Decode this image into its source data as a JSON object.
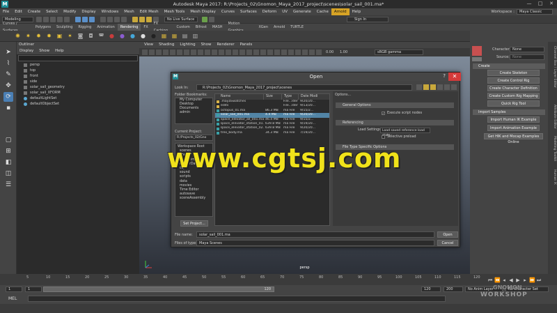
{
  "window": {
    "title": "Autodesk Maya 2017: R:\\Projects_02\\Gnomon_Maya_2017_project\\scenes\\solar_sail_001.ma*",
    "app_icon": "M",
    "minimize": "—",
    "maximize": "□",
    "close": "✕"
  },
  "menubar": {
    "items": [
      "File",
      "Edit",
      "Create",
      "Select",
      "Modify",
      "Display",
      "Windows",
      "Mesh",
      "Edit Mesh",
      "Mesh Tools",
      "Mesh Display",
      "Curves",
      "Surfaces",
      "Deform",
      "UV",
      "Generate",
      "Cache",
      "Arnold",
      "Help"
    ],
    "highlighted_index": 17,
    "workspace_label": "Workspace :",
    "workspace_value": "Maya Classic"
  },
  "statusline": {
    "mode": "Modeling",
    "live_surface": "No Live Surface",
    "sign_in": "Sign In"
  },
  "shelf_tabs": {
    "items": [
      "Curves / Surfaces",
      "Polygons",
      "Sculpting",
      "Rigging",
      "Animation",
      "Rendering",
      "FX",
      "FX Caching",
      "Custom",
      "Bifrost",
      "MASH",
      "Motion Graphics",
      "XGen",
      "Arnold",
      "TURTLE"
    ],
    "active_index": 5
  },
  "outliner": {
    "title": "Outliner",
    "menu": [
      "Display",
      "Show",
      "Help"
    ],
    "items": [
      "persp",
      "top",
      "front",
      "side",
      "solar_sail_geometry",
      "solar_sail_XFORM",
      "defaultLightSet",
      "defaultObjectSet"
    ]
  },
  "viewport": {
    "menu": [
      "View",
      "Shading",
      "Lighting",
      "Show",
      "Renderer",
      "Panels"
    ],
    "color_space": "sRGB gamma",
    "camera_label": "persp",
    "value_1": "0.00",
    "value_2": "1.00"
  },
  "right_panel": {
    "character_label": "Character:",
    "character_value": "None",
    "source_label": "Source:",
    "source_value": "None",
    "create_section": "Create",
    "create_buttons": [
      "Create Skeleton",
      "Create Control Rig",
      "Create Character Definition",
      "Create Custom Rig Mapping",
      "Quick Rig Tool"
    ],
    "import_section": "Import Samples",
    "import_buttons": [
      "Import Human IK Example",
      "Import Animation Example",
      "Get HIK and Mocap Examples Online"
    ],
    "vertical_tabs": [
      "Channel Box / Layer Editor",
      "Attribute Editor",
      "Modeling Toolkit",
      "Human IK"
    ]
  },
  "dialog": {
    "title": "Open",
    "help": "?",
    "close": "✕",
    "look_in_label": "Look In:",
    "look_in_value": "R:\\Projects_02\\Gnomon_Maya_2017_project\\scenes",
    "bookmarks_label": "Folder Bookmarks:",
    "bookmarks": [
      "My Computer",
      "Desktop",
      "Documents",
      "admin"
    ],
    "current_project_label": "Current Project:",
    "current_project_value": "R:/Projects_02/Gno",
    "project_tree": [
      "Workspace Root",
      "scenes",
      "images",
      "sourceimages",
      "renderData",
      "clips",
      "sound",
      "scripts",
      "data",
      "movies",
      "Time Editor",
      "autosave",
      "sceneAssembly"
    ],
    "set_project": "Set Project...",
    "columns": [
      "Name",
      "Size",
      "Type",
      "Date Modi"
    ],
    "files": [
      {
        "name": ".mayaSwatches",
        "size": "",
        "type": "File...lder",
        "date": "9/20/20..."
      },
      {
        "name": "edits",
        "size": "",
        "type": "File...lder",
        "date": "9/13/20..."
      },
      {
        "name": "octopus_01.ma",
        "size": "86.3 MB",
        "type": "ma File",
        "date": "9/15/2..."
      },
      {
        "name": "solar_sail_001.ma",
        "size": "4.4 MB",
        "type": "ma File",
        "date": "9/20/20..."
      },
      {
        "name": "space_elevator_all_001.ma",
        "size": "46.4 MB",
        "type": "ma File",
        "date": "9/15/2..."
      },
      {
        "name": "space_elevator_station_01.ma",
        "size": "639.8 MB",
        "type": "ma File",
        "date": "9/19/20..."
      },
      {
        "name": "space_elevator_station_02.ma",
        "size": "639.8 MB",
        "type": "ma File",
        "date": "9/20/20..."
      },
      {
        "name": "trex_body.ma",
        "size": "34.3 MB",
        "type": "ma File",
        "date": "7/19/20..."
      }
    ],
    "selected_file_index": 3,
    "options_label": "Options...",
    "general_options": "General Options",
    "execute_script_nodes": "Execute script nodes",
    "referencing": "Referencing",
    "load_settings_label": "Load Settings",
    "load_settings_value": "Load saved reference load state",
    "selective_preload": "Selective preload",
    "file_type_options": "File Type Specific Options",
    "file_name_label": "File name:",
    "file_name_value": "solar_sail_001.ma",
    "files_of_type_label": "Files of type:",
    "files_of_type_value": "Maya Scenes",
    "open_button": "Open",
    "cancel_button": "Cancel"
  },
  "timeslider": {
    "ticks": [
      "5",
      "10",
      "15",
      "20",
      "25",
      "30",
      "35",
      "40",
      "45",
      "50",
      "55",
      "60",
      "65",
      "70",
      "75",
      "80",
      "85",
      "90",
      "95",
      "100",
      "105",
      "110",
      "115",
      "120"
    ],
    "range_start": "1",
    "range_start_inner": "1",
    "range_inner_end": "120",
    "range_end": "120",
    "range_max": "200",
    "anim_layer": "No Anim Layer",
    "character_set": "No Character Set"
  },
  "cmdline": {
    "label": "MEL"
  },
  "watermark": {
    "text": "www.cgtsj.com",
    "brand_1": "GNOMON",
    "brand_2": "WORKSHOP"
  },
  "colors": {
    "highlight": "#d7a325",
    "selection": "#5285a6",
    "close_red": "#d43a3a",
    "watermark_yellow": "#f0e21a"
  }
}
